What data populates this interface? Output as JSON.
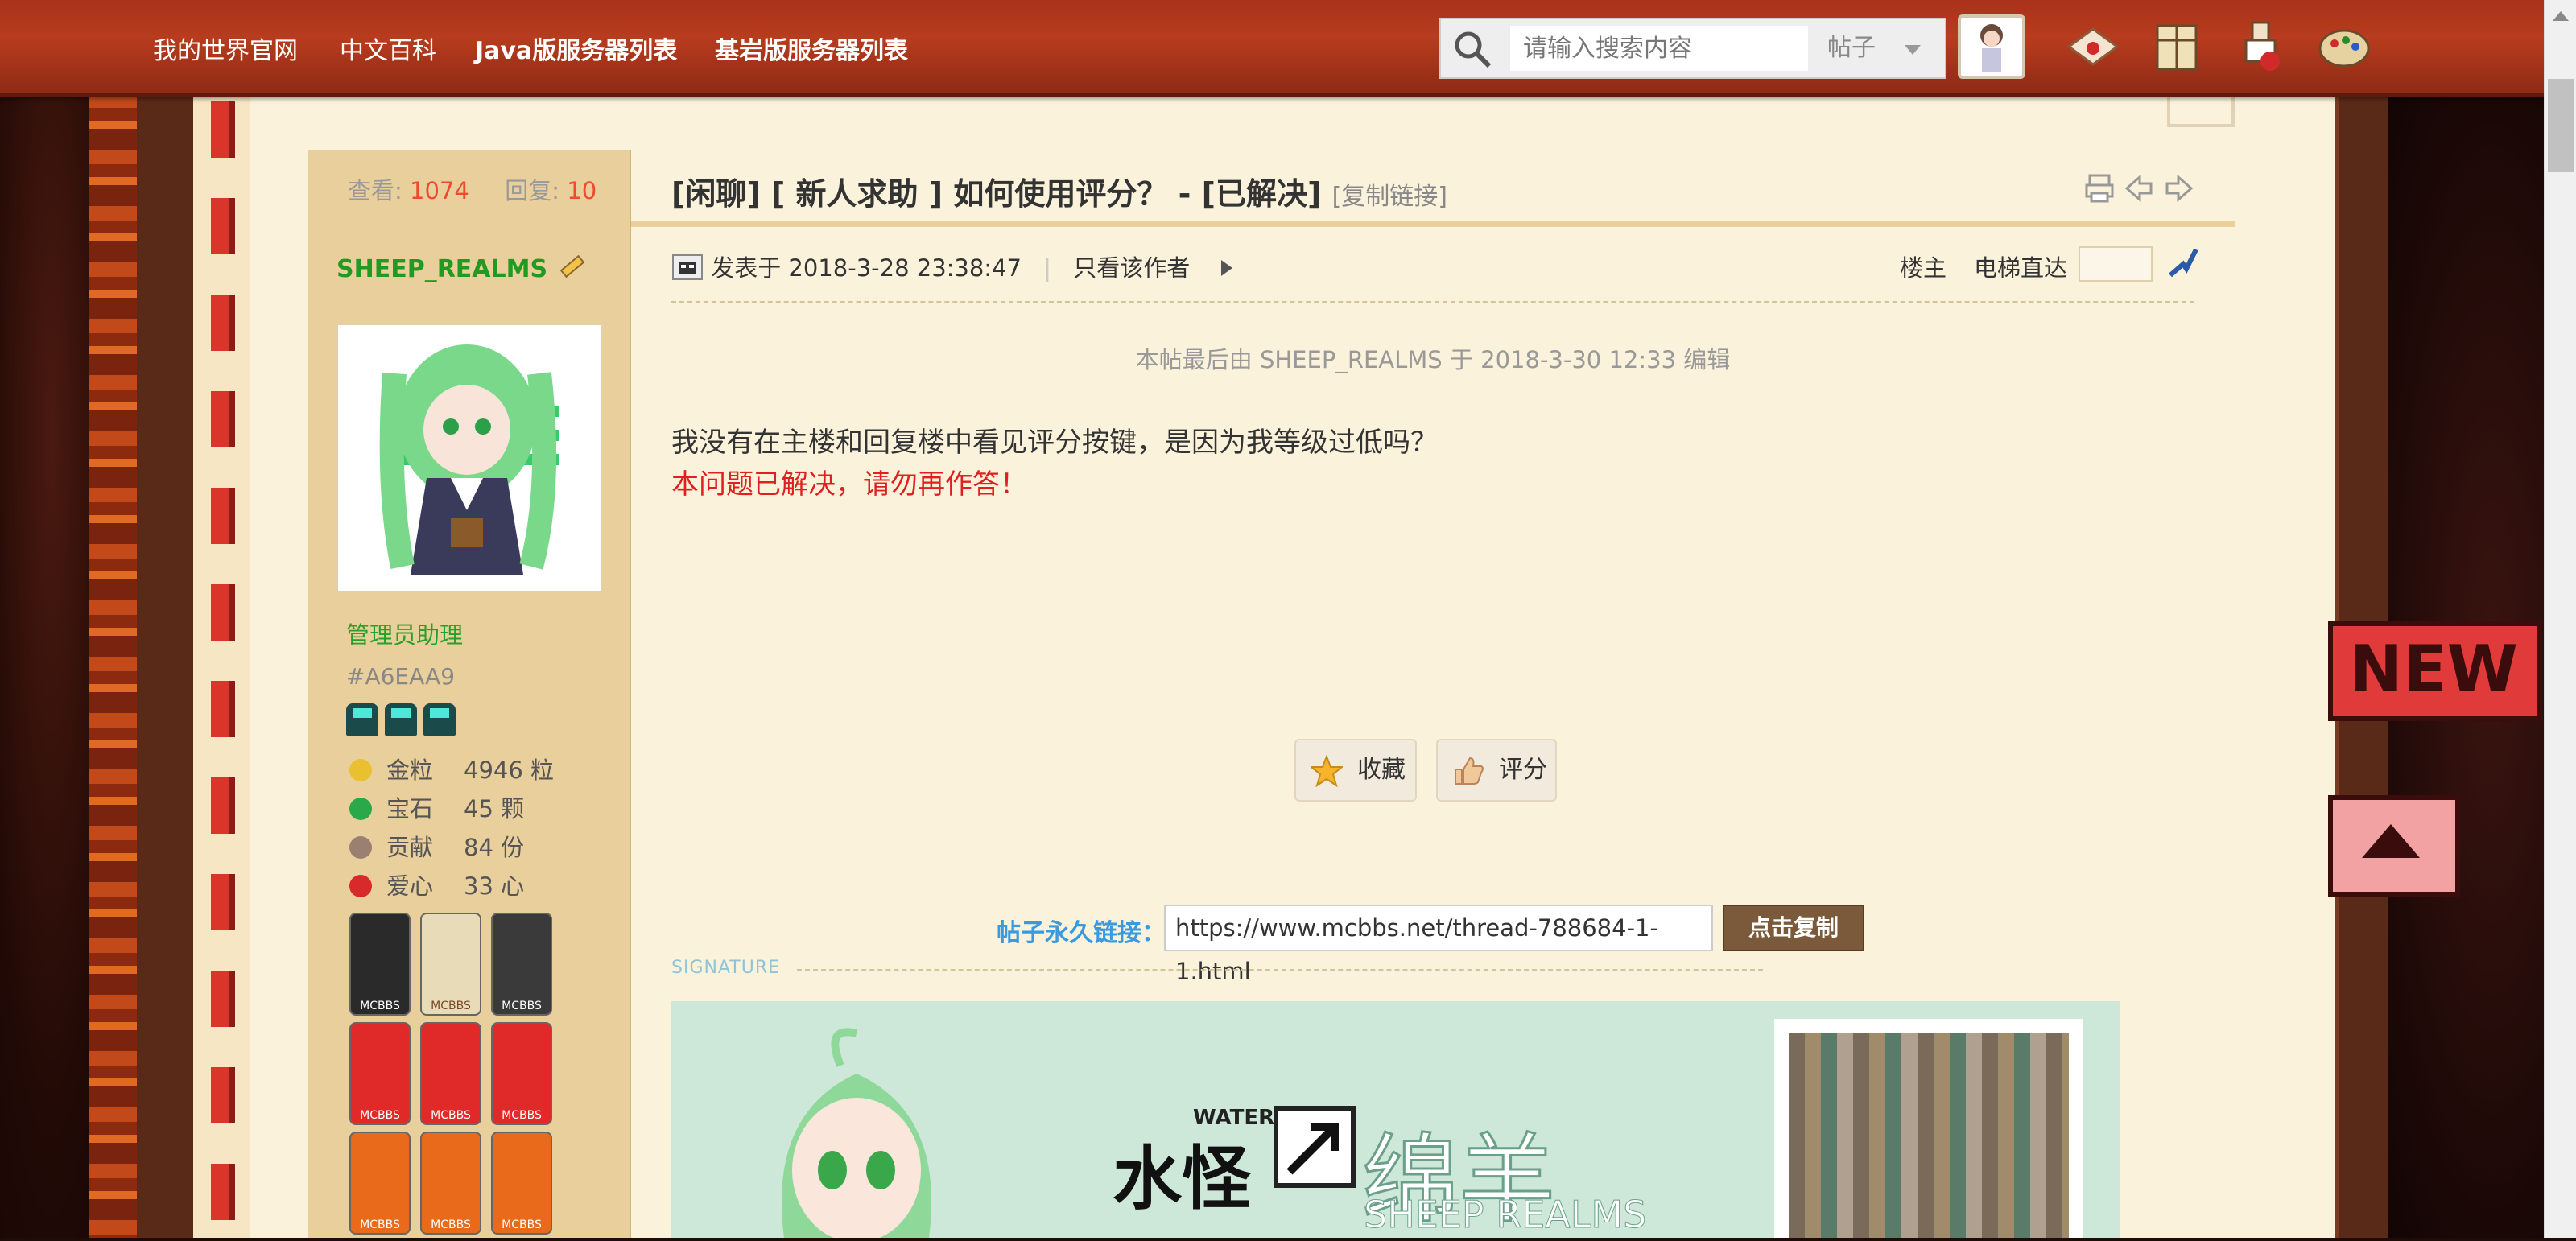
{
  "nav": {
    "items": [
      "我的世界官网",
      "中文百科",
      "Java版服务器列表",
      "基岩版服务器列表"
    ]
  },
  "search": {
    "placeholder": "请输入搜索内容",
    "type": "帖子"
  },
  "header_icons": [
    "avatar",
    "envelope-icon",
    "scroll-icon",
    "potion-icon",
    "palette-icon"
  ],
  "thread": {
    "views_label": "查看:",
    "views": "1074",
    "replies_label": "回复:",
    "replies": "10",
    "title": "[闲聊]  [ 新人求助 ] 如何使用评分？ - [已解决]",
    "copy_link": "[复制链接]"
  },
  "author": {
    "name": "SHEEP_REALMS",
    "group": "管理员助理",
    "uid": "#A6EAA9",
    "stats": [
      {
        "label": "金粒",
        "value": "4946 粒",
        "color": "#e8c030"
      },
      {
        "label": "宝石",
        "value": "45 颗",
        "color": "#2aa84a"
      },
      {
        "label": "贡献",
        "value": "84 份",
        "color": "#9a8070"
      },
      {
        "label": "爱心",
        "value": "33 心",
        "color": "#d82a2a"
      }
    ],
    "medals": [
      "MCBBS",
      "MCBBS",
      "MCBBS",
      "MCBBS",
      "MCBBS",
      "MCBBS",
      "MCBBS",
      "MCBBS",
      "MCBBS"
    ]
  },
  "post": {
    "posted": "发表于 2018-3-28 23:38:47",
    "only_author": "只看该作者",
    "floor": "楼主",
    "elevator": "电梯直达",
    "edit_note": "本帖最后由 SHEEP_REALMS 于 2018-3-30 12:33 编辑",
    "line1": "我没有在主楼和回复楼中看见评分按键，是因为我等级过低吗？",
    "line2": "本问题已解决，请勿再作答！",
    "favorite": "收藏",
    "rate": "评分",
    "permalink_label": "帖子永久链接：",
    "permalink": "https://www.mcbbs.net/thread-788684-1-1.html",
    "copy_button": "点击复制"
  },
  "signature": {
    "label": "SIGNATURE",
    "banner_water": "WATER",
    "banner_cn1": "水怪",
    "banner_cn2": "绵羊",
    "banner_en": "SHEEP REALMS"
  },
  "side_badges": {
    "new": "NEW"
  }
}
